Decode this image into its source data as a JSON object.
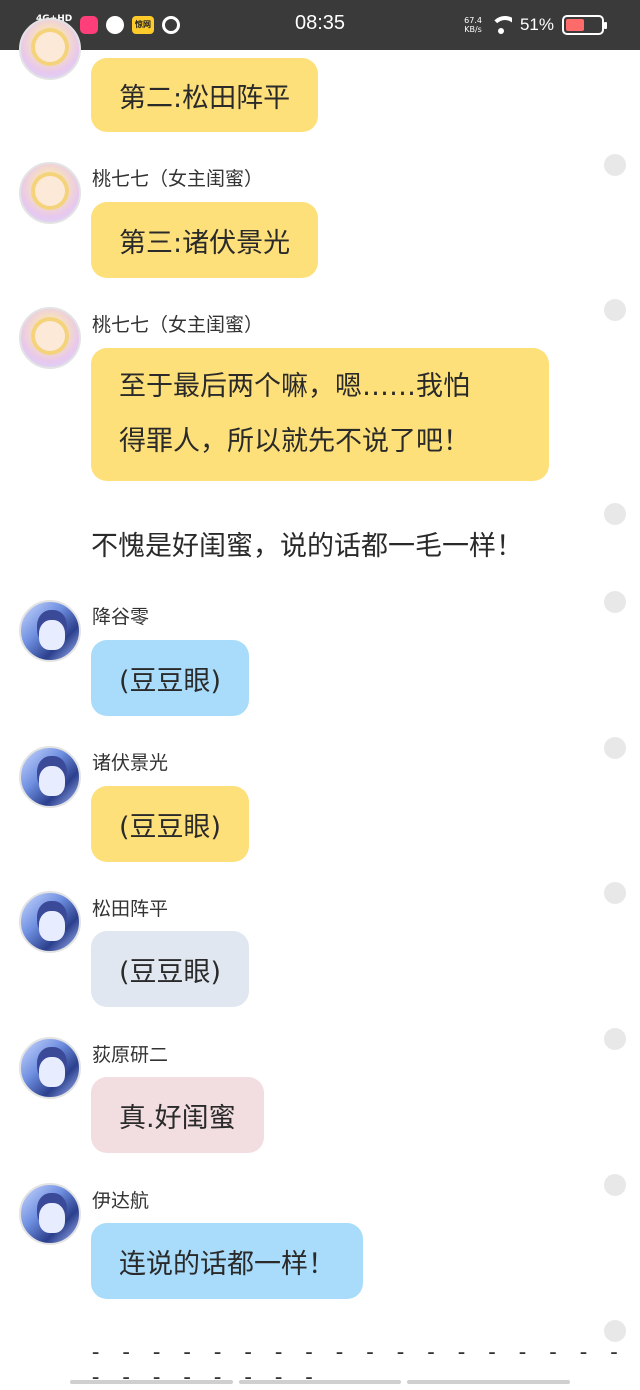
{
  "status_bar": {
    "network": "4G+HD",
    "time": "08:35",
    "speed_value": "67.4",
    "speed_unit": "KB/s",
    "battery": "51%",
    "app_icon_text": "惊网"
  },
  "messages": [
    {
      "text": "第二:松田阵平",
      "color": "yellow"
    },
    {
      "sender": "桃七七（女主闺蜜）",
      "text": "第三:诸伏景光",
      "color": "yellow"
    },
    {
      "sender": "桃七七（女主闺蜜）",
      "lines": [
        "至于最后两个嘛，嗯……我怕",
        "得罪人，所以就先不说了吧！"
      ],
      "color": "yellow"
    },
    {
      "text": "不愧是好闺蜜，说的话都一毛一样！"
    },
    {
      "sender": "降谷零",
      "text": "(豆豆眼)",
      "color": "blue"
    },
    {
      "sender": "诸伏景光",
      "text": "(豆豆眼)",
      "color": "yellow"
    },
    {
      "sender": "松田阵平",
      "text": "(豆豆眼)",
      "color": "gray"
    },
    {
      "sender": "荻原研二",
      "text": "真.好闺蜜",
      "color": "pink"
    },
    {
      "sender": "伊达航",
      "text": "连说的话都一样！",
      "color": "blue"
    }
  ],
  "divider": "- - - - - - - - - - - - - - - - - - - - - - - - - -",
  "colors": {
    "yellow": "#fee07a",
    "blue": "#a9dcfb",
    "gray": "#e1e7f0",
    "pink": "#f2dde0",
    "status_bar": "#3a3a3a"
  }
}
